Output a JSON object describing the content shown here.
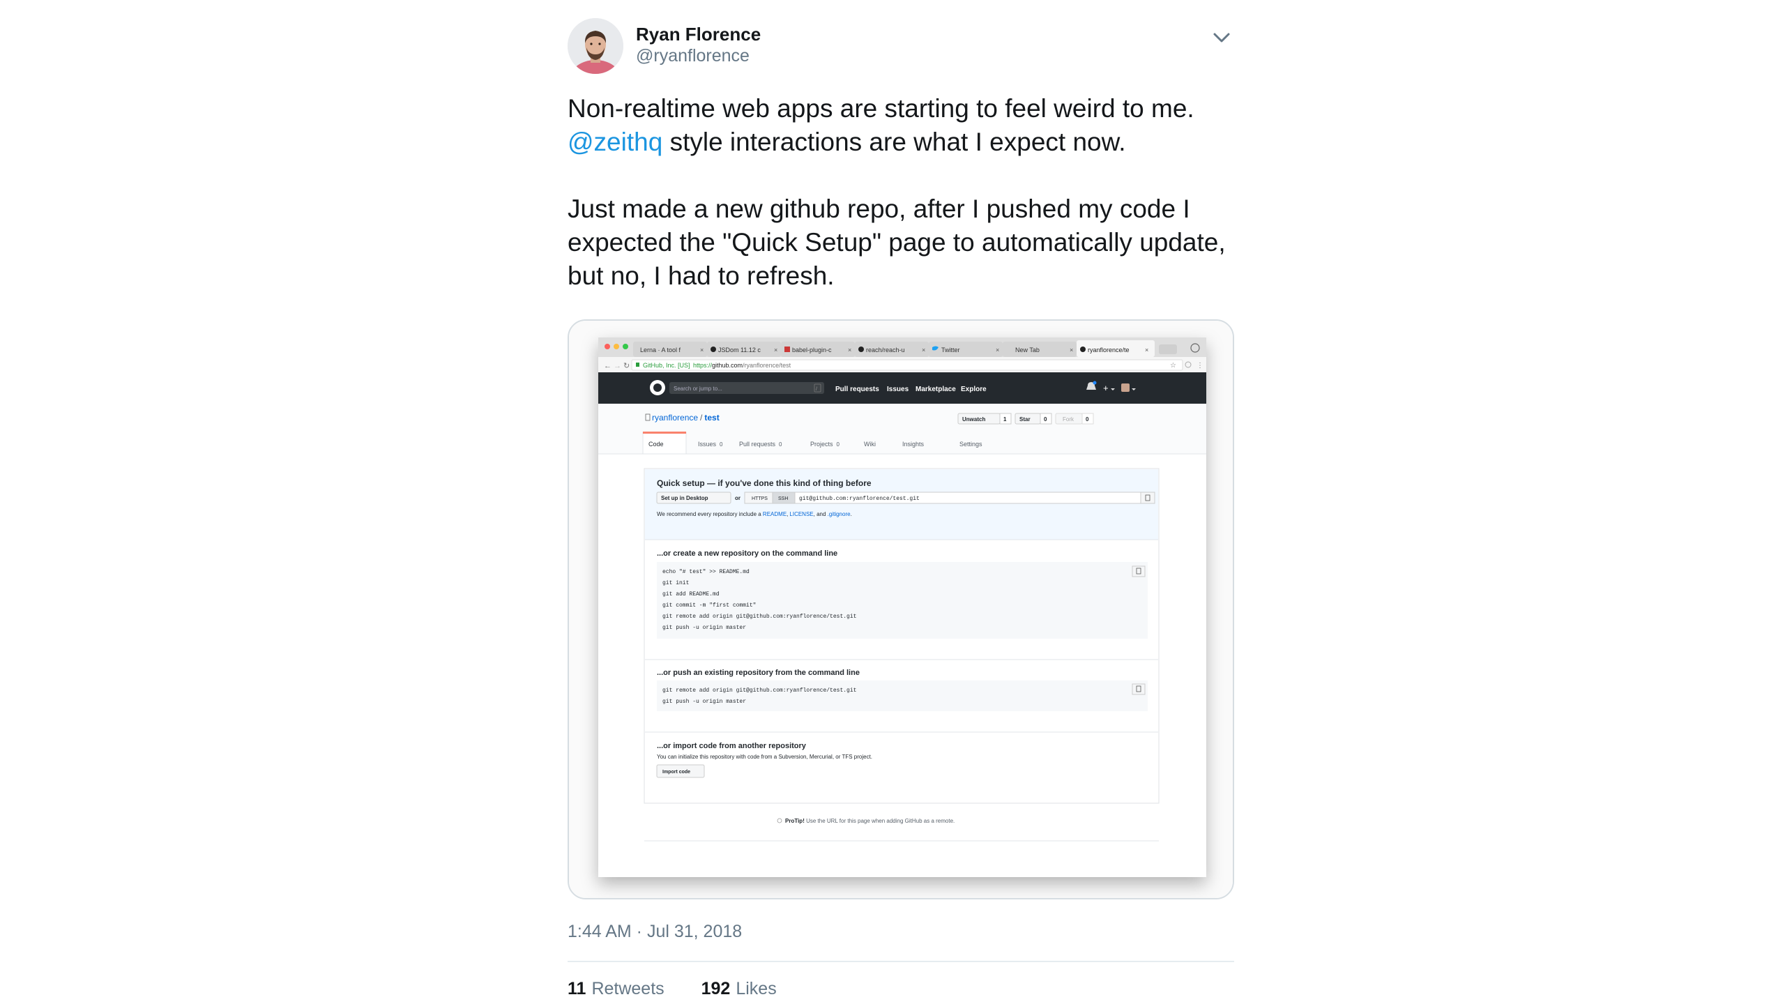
{
  "author": {
    "name": "Ryan Florence",
    "handle": "@ryanflorence"
  },
  "tweet": {
    "line1": "Non-realtime web apps are starting to feel weird to me.",
    "mention": "@zeithq",
    "line2_rest": " style interactions are what I expect now.",
    "line3": "Just made a new github repo, after I pushed my code I",
    "line4": "expected the \"Quick Setup\" page to automatically update,",
    "line5": "but no, I had to refresh."
  },
  "timestamp": "1:44 AM · Jul 31, 2018",
  "stats": {
    "retweets_count": "11",
    "retweets_label": "Retweets",
    "likes_count": "192",
    "likes_label": "Likes"
  },
  "screenshot": {
    "tabs": [
      "Lerna · A tool f",
      "JSDom 11.12 c",
      "babel-plugin-c",
      "reach/reach-u",
      "Twitter",
      "New Tab",
      "ryanflorence/te"
    ],
    "address": {
      "secure": "GitHub, Inc. [US]",
      "url_prefix": "https://",
      "url_host": "github.com",
      "url_path": "/ryanflorence/test"
    },
    "nav": {
      "search_placeholder": "Search or jump to...",
      "slash": "/",
      "links": [
        "Pull requests",
        "Issues",
        "Marketplace",
        "Explore"
      ],
      "plus": "+"
    },
    "repo": {
      "owner": "ryanflorence",
      "sep": "/",
      "name": "test"
    },
    "actions": {
      "unwatch": "Unwatch",
      "unwatch_count": "1",
      "star": "Star",
      "star_count": "0",
      "fork": "Fork",
      "fork_count": "0"
    },
    "repo_tabs": {
      "code": "Code",
      "issues": "Issues",
      "issues_count": "0",
      "prs": "Pull requests",
      "prs_count": "0",
      "projects": "Projects",
      "projects_count": "0",
      "wiki": "Wiki",
      "insights": "Insights",
      "settings": "Settings"
    },
    "quick": {
      "title": "Quick setup — if you've done this kind of thing before",
      "desktop": "Set up in Desktop",
      "or": "or",
      "https": "HTTPS",
      "ssh": "SSH",
      "clone_url": "git@github.com:ryanflorence/test.git",
      "recommend_a": "We recommend every repository include a ",
      "readme": "README",
      "comma": ",",
      "license": "LICENSE",
      "and": ", and ",
      "gitignore": ".gitignore",
      "period": "."
    },
    "create": {
      "title": "...or create a new repository on the command line",
      "lines": [
        "echo \"# test\" >> README.md",
        "git init",
        "git add README.md",
        "git commit -m \"first commit\"",
        "git remote add origin git@github.com:ryanflorence/test.git",
        "git push -u origin master"
      ]
    },
    "push": {
      "title": "...or push an existing repository from the command line",
      "lines": [
        "git remote add origin git@github.com:ryanflorence/test.git",
        "git push -u origin master"
      ]
    },
    "import": {
      "title": "...or import code from another repository",
      "desc": "You can initialize this repository with code from a Subversion, Mercurial, or TFS project.",
      "button": "Import code"
    },
    "protip": {
      "label": "ProTip!",
      "text": " Use the URL for this page when adding GitHub as a remote."
    }
  }
}
